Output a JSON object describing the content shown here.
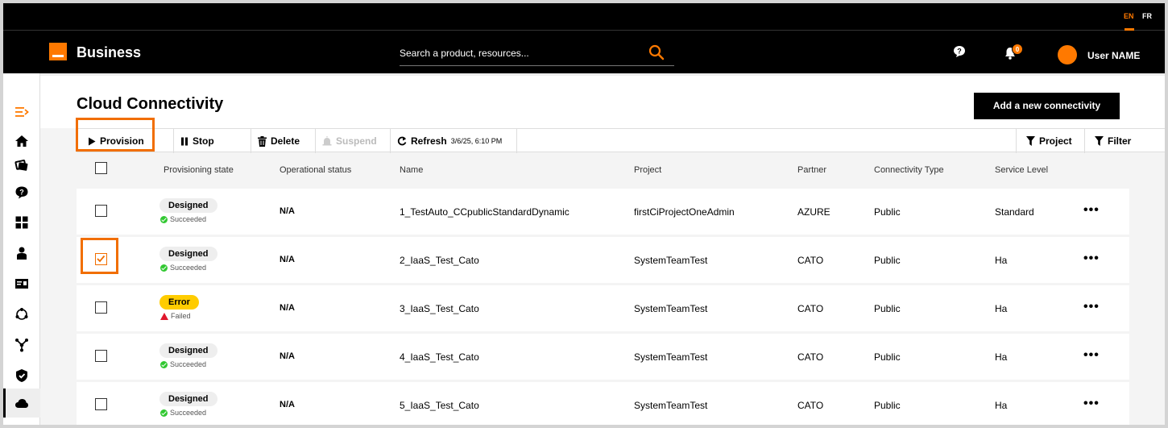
{
  "header": {
    "languages": [
      "EN",
      "FR"
    ],
    "active_language": "EN",
    "brand": "Business",
    "search_placeholder": "Search a product, resources...",
    "notification_count": "0",
    "user_name": "User NAME"
  },
  "sidebar": {
    "icons": [
      "menu-expand-icon",
      "home-icon",
      "gallery-icon",
      "help-icon",
      "dashboard-icon",
      "user-icon",
      "id-card-icon",
      "network-icon",
      "topology-icon",
      "shield-icon",
      "cloud-icon"
    ],
    "active": "cloud-icon"
  },
  "page": {
    "title": "Cloud Connectivity",
    "add_button": "Add a new connectivity"
  },
  "toolbar": {
    "provision": "Provision",
    "stop": "Stop",
    "delete": "Delete",
    "suspend": "Suspend",
    "refresh": "Refresh",
    "refresh_time": "3/6/25, 6:10 PM",
    "project": "Project",
    "filter": "Filter"
  },
  "table": {
    "columns": [
      "Provisioning state",
      "Operational status",
      "Name",
      "Project",
      "Partner",
      "Connectivity Type",
      "Service Level"
    ],
    "rows": [
      {
        "state": "Designed",
        "substate": "Succeeded",
        "status": "N/A",
        "name": "1_TestAuto_CCpublicStandardDynamic",
        "project": "firstCiProjectOneAdmin",
        "partner": "AZURE",
        "type": "Public",
        "level": "Standard",
        "checked": false
      },
      {
        "state": "Designed",
        "substate": "Succeeded",
        "status": "N/A",
        "name": "2_IaaS_Test_Cato",
        "project": "SystemTeamTest",
        "partner": "CATO",
        "type": "Public",
        "level": "Ha",
        "checked": true
      },
      {
        "state": "Error",
        "substate": "Failed",
        "status": "N/A",
        "name": "3_IaaS_Test_Cato",
        "project": "SystemTeamTest",
        "partner": "CATO",
        "type": "Public",
        "level": "Ha",
        "checked": false
      },
      {
        "state": "Designed",
        "substate": "Succeeded",
        "status": "N/A",
        "name": "4_IaaS_Test_Cato",
        "project": "SystemTeamTest",
        "partner": "CATO",
        "type": "Public",
        "level": "Ha",
        "checked": false
      },
      {
        "state": "Designed",
        "substate": "Succeeded",
        "status": "N/A",
        "name": "5_IaaS_Test_Cato",
        "project": "SystemTeamTest",
        "partner": "CATO",
        "type": "Public",
        "level": "Ha",
        "checked": false
      }
    ],
    "more_label": "•••"
  },
  "colors": {
    "accent": "#ff7900",
    "highlight": "#f16e00",
    "error_pill": "#ffcc00",
    "success": "#32c832",
    "error": "#e0182d"
  }
}
